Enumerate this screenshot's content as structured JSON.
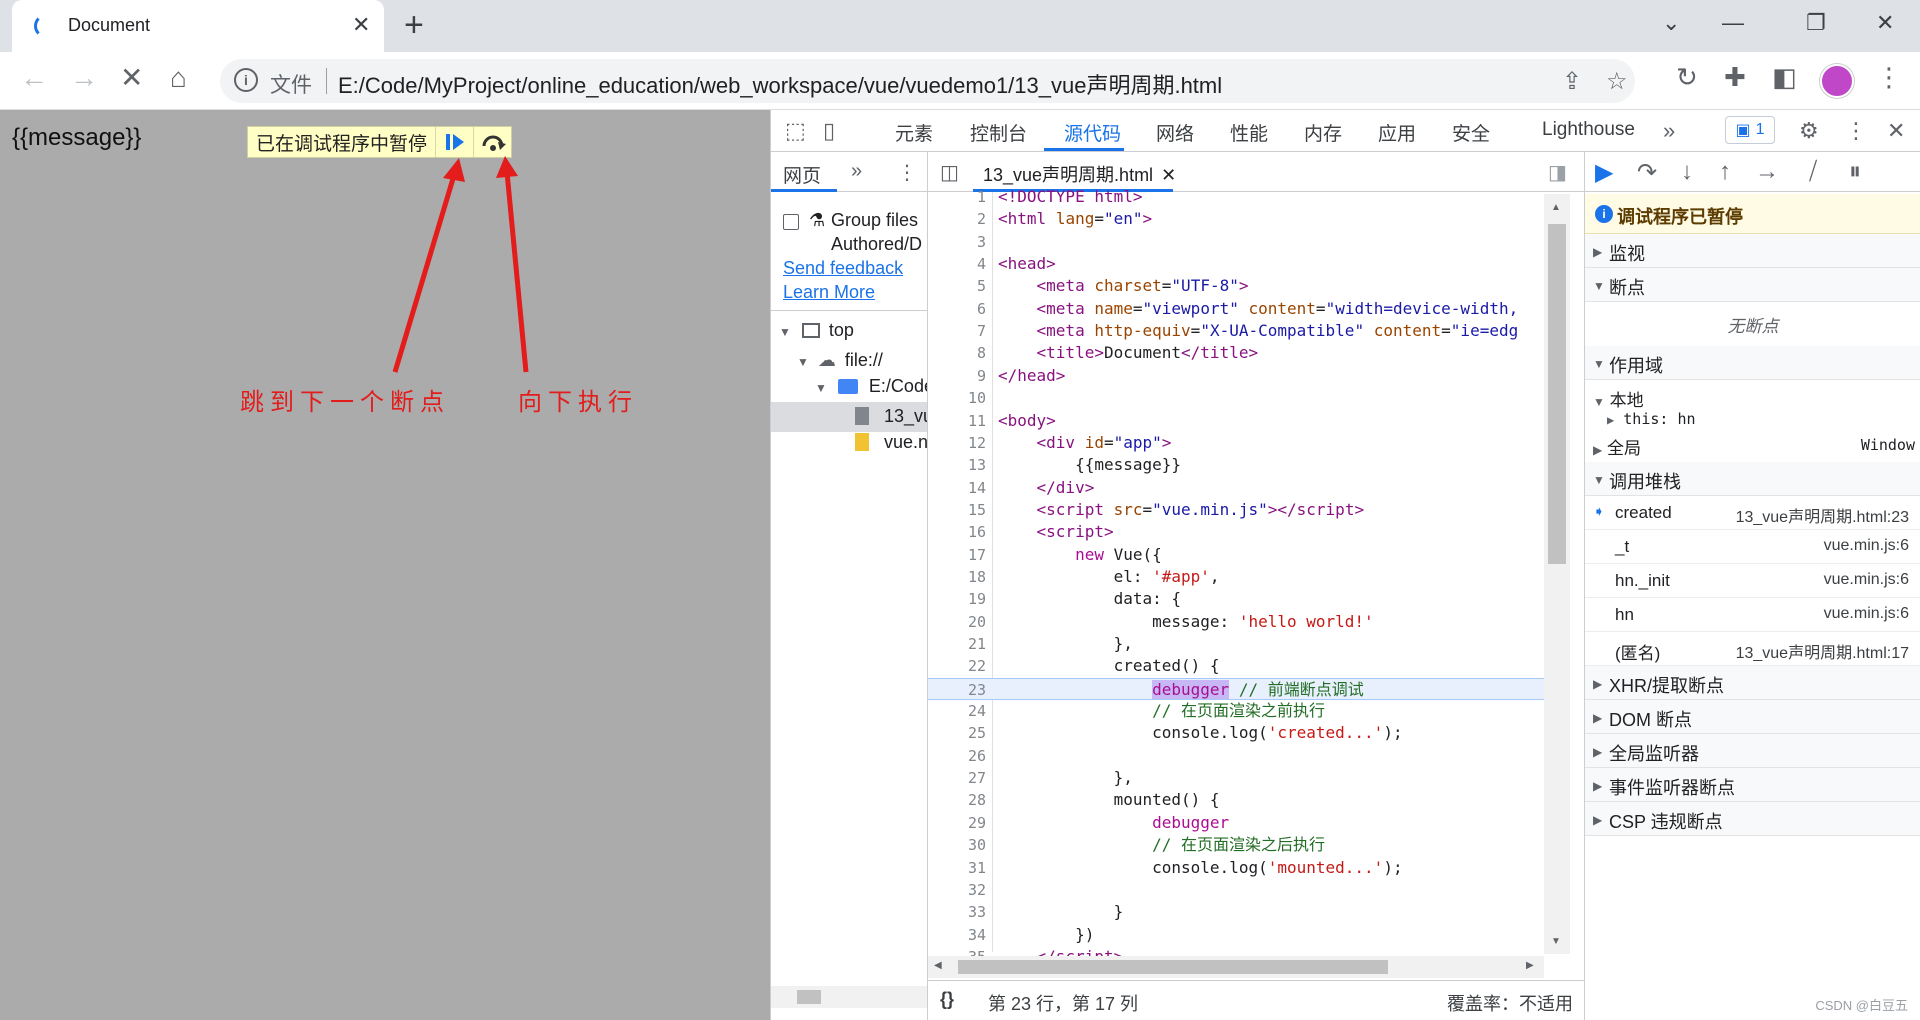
{
  "browser": {
    "tab_title": "Document",
    "address_scheme": "文件",
    "address_url": "E:/Code/MyProject/online_education/web_workspace/vue/vuedemo1/13_vue声明周期.html"
  },
  "page": {
    "message": "{{message}}",
    "paused_label": "已在调试程序中暂停",
    "annotation_resume": "跳到下一个断点",
    "annotation_step": "向下执行"
  },
  "devtools": {
    "tabs": [
      "元素",
      "控制台",
      "源代码",
      "网络",
      "性能",
      "内存",
      "应用",
      "安全",
      "Lighthouse"
    ],
    "active_tab": "源代码",
    "issues_count": "1",
    "navigator": {
      "tab": "网页",
      "group_files": "Group files",
      "authored": "Authored/D",
      "send_feedback": "Send feedback",
      "learn_more": "Learn More",
      "tree": [
        {
          "label": "top"
        },
        {
          "label": "file://"
        },
        {
          "label": "E:/Code"
        },
        {
          "label": "13_vu"
        },
        {
          "label": "vue.n"
        }
      ]
    },
    "editor": {
      "file_tab": "13_vue声明周期.html",
      "status_position": "第 23 行，第 17 列",
      "status_coverage": "覆盖率：不适用",
      "format_icon": "{}",
      "highlight_line": 23
    },
    "sidebar": {
      "paused_title": "调试程序已暂停",
      "sections": {
        "watch": "监视",
        "breakpoints": "断点",
        "no_breakpoints": "无断点",
        "scope": "作用域",
        "local": "本地",
        "this_label": "this: hn",
        "global": "全局",
        "global_value": "Window",
        "call_stack": "调用堆栈",
        "xhr": "XHR/提取断点",
        "dom": "DOM 断点",
        "global_listeners": "全局监听器",
        "event_listeners": "事件监听器断点",
        "csp": "CSP 违规断点"
      },
      "call_stack": [
        {
          "fn": "created",
          "loc": "13_vue声明周期.html:23"
        },
        {
          "fn": "_t",
          "loc": "vue.min.js:6"
        },
        {
          "fn": "hn._init",
          "loc": "vue.min.js:6"
        },
        {
          "fn": "hn",
          "loc": "vue.min.js:6"
        },
        {
          "fn": "(匿名)",
          "loc": "13_vue声明周期.html:17"
        }
      ]
    }
  },
  "watermark": "CSDN @白豆五",
  "colors": {
    "accent": "#1a73e8",
    "annotation": "#e31c1c",
    "page_bg": "#ababab"
  }
}
